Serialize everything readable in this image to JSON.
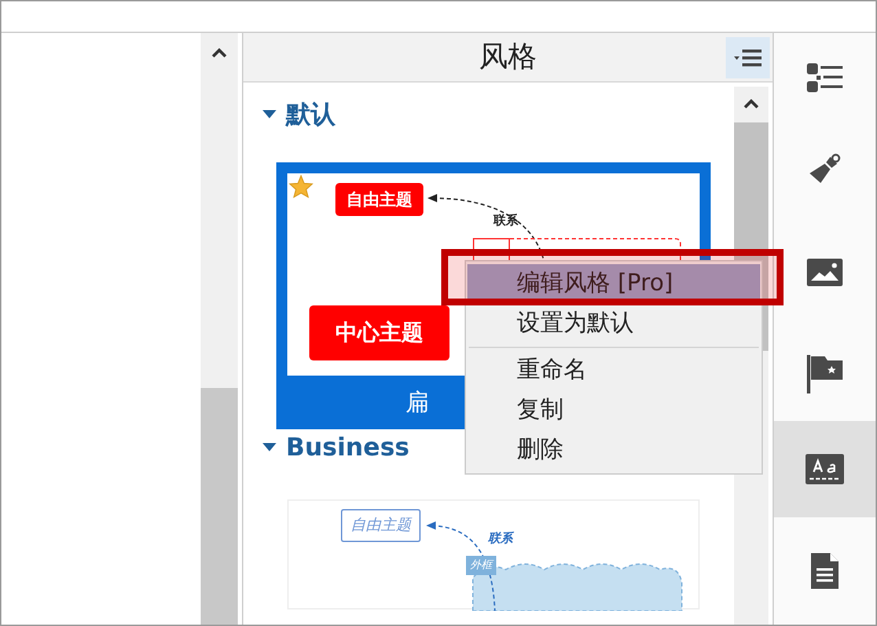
{
  "panel": {
    "title": "风格"
  },
  "groups": [
    {
      "label": "默认",
      "expanded": true,
      "card": {
        "kind": "default",
        "selected": true,
        "favorite": true,
        "free_topic": "自由主题",
        "relation": "联系",
        "central_topic": "中心主题",
        "caption": "扁"
      }
    },
    {
      "label": "Business",
      "expanded": true,
      "card": {
        "kind": "business",
        "selected": false,
        "free_topic": "自由主题",
        "relation": "联系",
        "boundary": "外框"
      }
    }
  ],
  "context_menu": {
    "sections": [
      [
        {
          "label": "编辑风格 [Pro]",
          "selected": true
        },
        {
          "label": "设置为默认",
          "selected": false
        }
      ],
      [
        {
          "label": "重命名",
          "selected": false
        },
        {
          "label": "复制",
          "selected": false
        },
        {
          "label": "删除",
          "selected": false
        }
      ]
    ]
  },
  "sidebar": {
    "items": [
      {
        "kind": "outline",
        "selected": false
      },
      {
        "kind": "brush",
        "selected": false
      },
      {
        "kind": "image",
        "selected": false
      },
      {
        "kind": "flag",
        "selected": false
      },
      {
        "kind": "text-style",
        "selected": true
      },
      {
        "kind": "document",
        "selected": false
      }
    ]
  }
}
